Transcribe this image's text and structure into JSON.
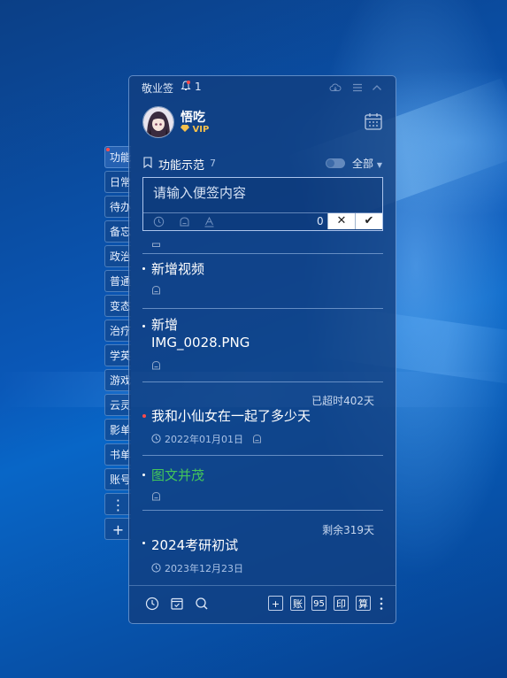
{
  "app": {
    "title": "敬业签",
    "notification_count": "1"
  },
  "user": {
    "name": "悟吃",
    "badge": "VIP"
  },
  "group": {
    "name": "功能示范",
    "count": "7",
    "filter": "全部"
  },
  "input": {
    "placeholder": "请输入便签内容",
    "char_count": "0",
    "cancel": "✕",
    "confirm": "✔"
  },
  "side_tabs": [
    {
      "label": "功能示范"
    },
    {
      "label": "日常"
    },
    {
      "label": "待办"
    },
    {
      "label": "备忘"
    },
    {
      "label": "政治"
    },
    {
      "label": "普通"
    },
    {
      "label": "变态"
    },
    {
      "label": "治疗"
    },
    {
      "label": "学英"
    },
    {
      "label": "游戏"
    },
    {
      "label": "云灵"
    },
    {
      "label": "影单"
    },
    {
      "label": "书单"
    },
    {
      "label": "账号"
    }
  ],
  "side_tools": {
    "more": "⋮",
    "add": "+"
  },
  "notes": [
    {
      "title": "新增视频"
    },
    {
      "title_line1": "新增",
      "title_line2": "IMG_0028.PNG"
    },
    {
      "title": "我和小仙女在一起了多少天",
      "status": "已超时402天",
      "date": "2022年01月01日"
    },
    {
      "title": "图文并茂"
    },
    {
      "title": "2024考研初试",
      "status": "剩余319天",
      "date": "2023年12月23日"
    }
  ],
  "bottom_buttons": {
    "add": "+",
    "account": "账",
    "num": "95",
    "print": "印",
    "calc": "算"
  },
  "colors": {
    "accent_green": "#43c65a",
    "alert_red": "#ff4b4b",
    "vip_gold": "#f6c14c",
    "panel": "#123e80"
  }
}
